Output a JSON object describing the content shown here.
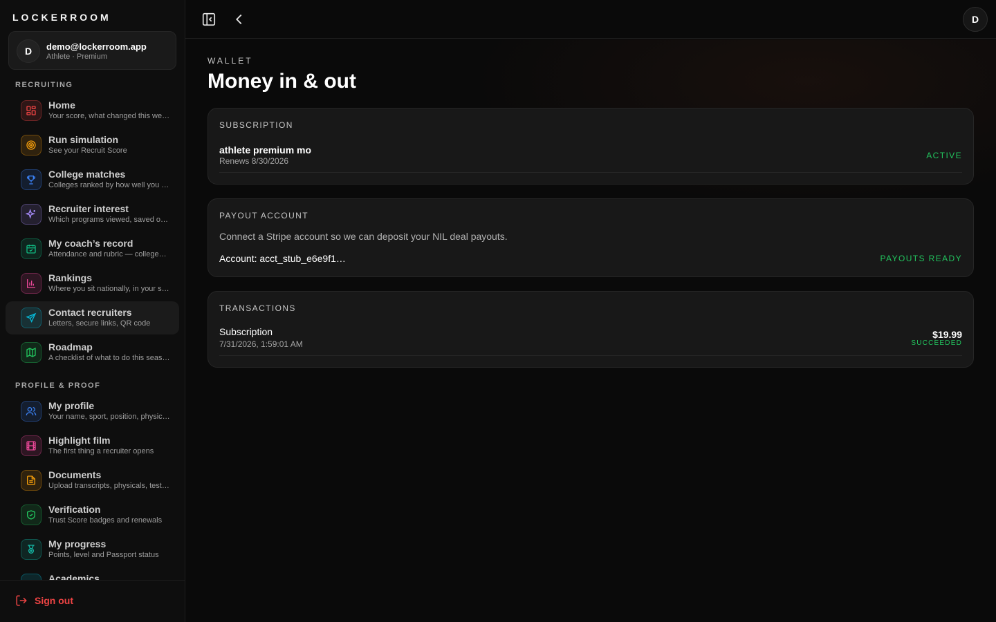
{
  "brand": "LOCKERROOM",
  "account": {
    "initial": "D",
    "email": "demo@lockerroom.app",
    "role": "Athlete · Premium"
  },
  "sections": {
    "recruiting": "RECRUITING",
    "profile_proof": "PROFILE & PROOF"
  },
  "nav_recruiting": [
    {
      "title": "Home",
      "subtitle": "Your score, what changed this we…",
      "icon": "grid-icon",
      "color": "#ef4444"
    },
    {
      "title": "Run simulation",
      "subtitle": "See your Recruit Score",
      "icon": "target-icon",
      "color": "#f59e0b"
    },
    {
      "title": "College matches",
      "subtitle": "Colleges ranked by how well you …",
      "icon": "trophy-icon",
      "color": "#3b82f6"
    },
    {
      "title": "Recruiter interest",
      "subtitle": "Which programs viewed, saved o…",
      "icon": "sparkles-icon",
      "color": "#a78bfa"
    },
    {
      "title": "My coach’s record",
      "subtitle": "Attendance and rubric — college…",
      "icon": "calendar-check-icon",
      "color": "#10b981"
    },
    {
      "title": "Rankings",
      "subtitle": "Where you sit nationally, in your s…",
      "icon": "bar-chart-icon",
      "color": "#ec4899"
    },
    {
      "title": "Contact recruiters",
      "subtitle": "Letters, secure links, QR code",
      "icon": "send-icon",
      "color": "#06b6d4"
    },
    {
      "title": "Roadmap",
      "subtitle": "A checklist of what to do this seas…",
      "icon": "map-icon",
      "color": "#22c55e"
    }
  ],
  "nav_profile": [
    {
      "title": "My profile",
      "subtitle": "Your name, sport, position, physic…",
      "icon": "users-icon",
      "color": "#3b82f6"
    },
    {
      "title": "Highlight film",
      "subtitle": "The first thing a recruiter opens",
      "icon": "film-icon",
      "color": "#ec4899"
    },
    {
      "title": "Documents",
      "subtitle": "Upload transcripts, physicals, test…",
      "icon": "file-text-icon",
      "color": "#f59e0b"
    },
    {
      "title": "Verification",
      "subtitle": "Trust Score badges and renewals",
      "icon": "shield-check-icon",
      "color": "#22c55e"
    },
    {
      "title": "My progress",
      "subtitle": "Points, level and Passport status",
      "icon": "medal-icon",
      "color": "#14b8a6"
    },
    {
      "title": "Academics",
      "subtitle": "",
      "icon": "academics-icon",
      "color": "#06b6d4"
    }
  ],
  "signout": "Sign out",
  "topbar": {
    "avatar_initial": "D"
  },
  "page": {
    "eyebrow": "WALLET",
    "title": "Money in & out"
  },
  "subscription": {
    "label": "SUBSCRIPTION",
    "plan": "athlete premium mo",
    "renews": "Renews 8/30/2026",
    "status": "ACTIVE"
  },
  "payout": {
    "label": "PAYOUT ACCOUNT",
    "description": "Connect a Stripe account so we can deposit your NIL deal payouts.",
    "account": "Account: acct_stub_e6e9f1…",
    "status": "PAYOUTS READY"
  },
  "transactions": {
    "label": "TRANSACTIONS",
    "items": [
      {
        "name": "Subscription",
        "date": "7/31/2026, 1:59:01 AM",
        "amount": "$19.99",
        "status": "SUCCEEDED"
      }
    ]
  },
  "colors": {
    "accent_green": "#22c55e",
    "danger": "#ef4444",
    "background": "#0a0a0a",
    "card": "#181818"
  }
}
